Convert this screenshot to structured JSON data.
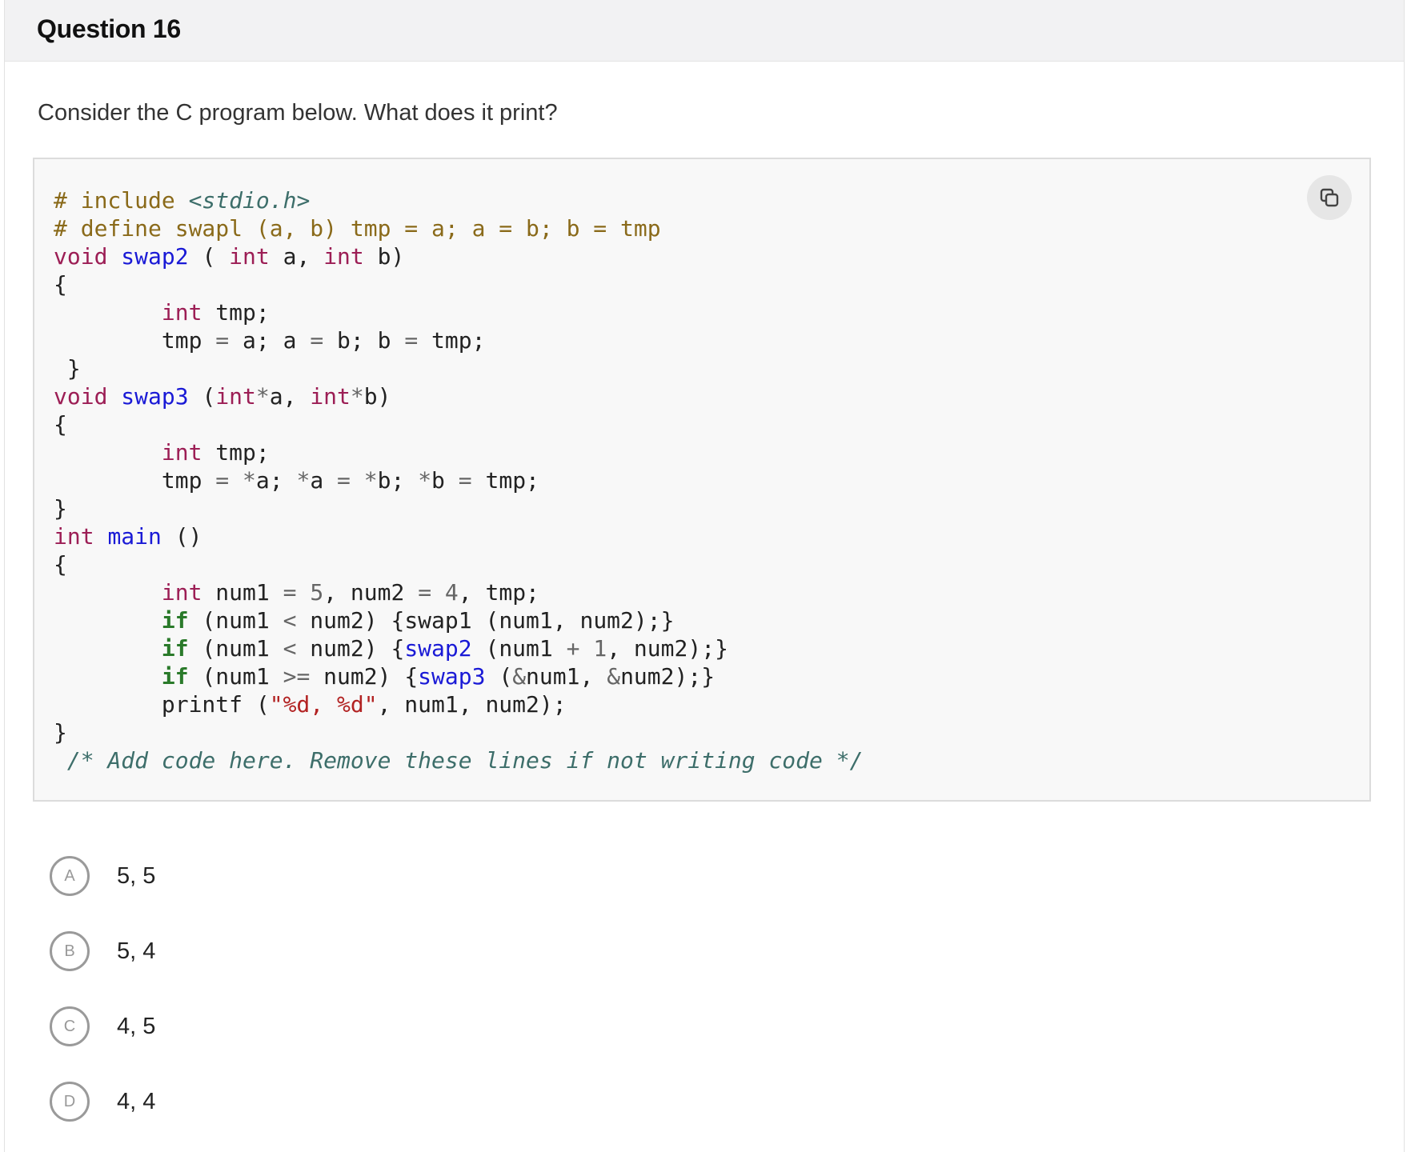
{
  "header": {
    "title": "Question 16"
  },
  "question": {
    "prompt": "Consider the C program below. What does it print?"
  },
  "code": {
    "language": "c",
    "lines": [
      "# include <stdio.h>",
      "# define swapl (a, b) tmp = a; a = b; b = tmp",
      "void swap2 ( int a, int b)",
      "{",
      "        int tmp;",
      "        tmp = a; a = b; b = tmp;",
      " }",
      "void swap3 (int*a, int*b)",
      "{",
      "        int tmp;",
      "        tmp = *a; *a = *b; *b = tmp;",
      "}",
      "int main ()",
      "{",
      "        int num1 = 5, num2 = 4, tmp;",
      "        if (num1 < num2) {swap1 (num1, num2);}",
      "        if (num1 < num2) {swap2 (num1 + 1, num2);}",
      "        if (num1 >= num2) {swap3 (&num1, &num2);}",
      "        printf (\"%d, %d\", num1, num2);",
      "}",
      " /* Add code here. Remove these lines if not writing code */"
    ],
    "copy_icon": "copy-icon"
  },
  "options": [
    {
      "letter": "A",
      "text": "5, 5"
    },
    {
      "letter": "B",
      "text": "5, 4"
    },
    {
      "letter": "C",
      "text": "4, 5"
    },
    {
      "letter": "D",
      "text": "4, 4"
    }
  ]
}
